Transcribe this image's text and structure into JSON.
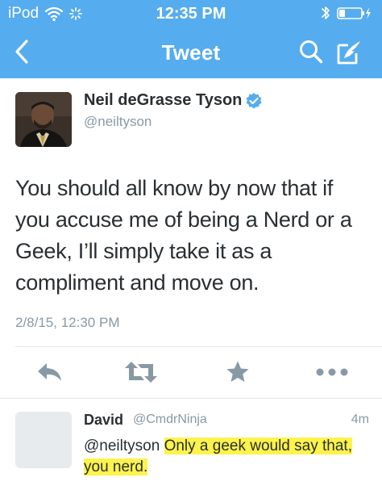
{
  "status_bar": {
    "carrier": "iPod",
    "time": "12:35 PM"
  },
  "nav": {
    "title": "Tweet",
    "icons": [
      "chevron-left-icon",
      "search-icon",
      "compose-icon"
    ]
  },
  "tweet": {
    "author": {
      "name": "Neil deGrasse Tyson",
      "handle": "@neiltyson",
      "verified": true
    },
    "text": "You should all know by now that if you accuse me of being a Nerd or a Geek, I’ll simply take it as a compliment and move on.",
    "timestamp": "2/8/15, 12:30 PM",
    "actions": [
      "reply-icon",
      "retweet-icon",
      "star-icon",
      "more-icon"
    ]
  },
  "reply": {
    "name": "David",
    "handle": "@CmdrNinja",
    "time": "4m",
    "mention": "@neiltyson",
    "text_highlighted": "Only a geek would say that, you nerd."
  },
  "colors": {
    "header": "#55acee",
    "verified": "#55acee",
    "text": "#292f33",
    "secondary_text": "#8899a6",
    "action_icons": "#8899a6",
    "highlight": "#fdf34b"
  }
}
